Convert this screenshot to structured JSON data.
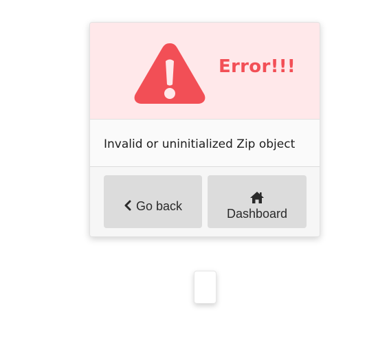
{
  "header": {
    "title": "Error!!!",
    "icon": "warning-triangle-icon",
    "accent_color": "#f24f56",
    "background_color": "#ffe8ea"
  },
  "body": {
    "message": "Invalid or uninitialized Zip object"
  },
  "footer": {
    "back_button": {
      "label": "Go back",
      "icon": "chevron-left-icon"
    },
    "dashboard_button": {
      "label": "Dashboard",
      "icon": "home-icon"
    }
  }
}
